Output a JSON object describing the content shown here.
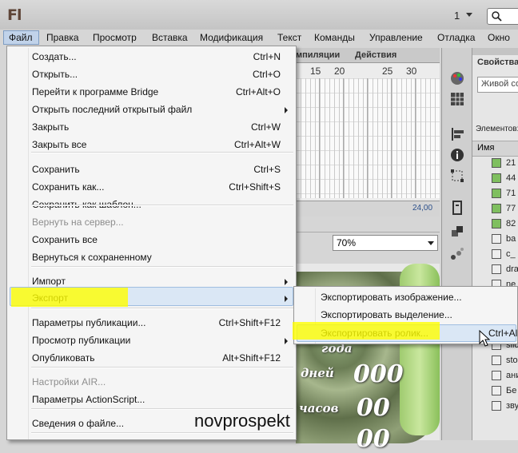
{
  "title_bar": {
    "logo": "Fl",
    "workspace_number": "1"
  },
  "menubar": {
    "items": [
      "Файл",
      "Правка",
      "Просмотр",
      "Вставка",
      "Модификация",
      "Текст",
      "Команды",
      "Управление",
      "Отладка",
      "Окно"
    ],
    "active": "Файл"
  },
  "file_menu": {
    "items": [
      {
        "label": "Создать...",
        "shortcut": "Ctrl+N"
      },
      {
        "label": "Открыть...",
        "shortcut": "Ctrl+O"
      },
      {
        "label": "Перейти к программе Bridge",
        "shortcut": "Ctrl+Alt+O"
      },
      {
        "label": "Открыть последний открытый файл",
        "shortcut": ""
      },
      {
        "label": "Закрыть",
        "shortcut": "Ctrl+W"
      },
      {
        "label": "Закрыть все",
        "shortcut": "Ctrl+Alt+W"
      },
      {
        "label": "Сохранить",
        "shortcut": "Ctrl+S"
      },
      {
        "label": "Сохранить как...",
        "shortcut": "Ctrl+Shift+S"
      },
      {
        "label": "Сохранить как шаблон...",
        "shortcut": ""
      },
      {
        "label": "Вернуть на сервер...",
        "shortcut": ""
      },
      {
        "label": "Сохранить все",
        "shortcut": ""
      },
      {
        "label": "Вернуться к сохраненному",
        "shortcut": ""
      },
      {
        "label": "Импорт",
        "shortcut": ""
      },
      {
        "label": "Экспорт",
        "shortcut": ""
      },
      {
        "label": "Параметры публикации...",
        "shortcut": "Ctrl+Shift+F12"
      },
      {
        "label": "Просмотр публикации",
        "shortcut": ""
      },
      {
        "label": "Опубликовать",
        "shortcut": "Alt+Shift+F12"
      },
      {
        "label": "Настройки AIR...",
        "shortcut": ""
      },
      {
        "label": "Параметры ActionScript...",
        "shortcut": ""
      },
      {
        "label": "Сведения о файле...",
        "shortcut": ""
      }
    ]
  },
  "export_submenu": {
    "items": [
      {
        "label": "Экспортировать изображение...",
        "shortcut": ""
      },
      {
        "label": "Экспортировать выделение...",
        "shortcut": ""
      },
      {
        "label": "Экспортировать ролик...",
        "shortcut": "Ctrl+Al"
      }
    ]
  },
  "timeline": {
    "tabs": [
      "мпиляции",
      "Действия"
    ],
    "ruler": [
      "15",
      "20",
      "25",
      "30"
    ],
    "fps": "24,00"
  },
  "stage": {
    "zoom": "70%",
    "text_year": "года",
    "text_days": "дней",
    "text_hours": "часов",
    "value_days": "000",
    "value_hours": "00",
    "value_minutes": "00"
  },
  "right_panel": {
    "title": "Свойства",
    "input": "Живой соу",
    "elements_label": "Элементов:",
    "column": "Имя",
    "items": [
      "21",
      "44",
      "71",
      "77",
      "82",
      "ba",
      "c_",
      "dra",
      "ne",
      "ox",
      "pre",
      "rac",
      "slic",
      "sto",
      "ани",
      "Бе",
      "зву"
    ]
  },
  "watermark": "novprospekt",
  "colors": {
    "menu_highlight": "#dae7f5",
    "marker": "#ffff00"
  }
}
